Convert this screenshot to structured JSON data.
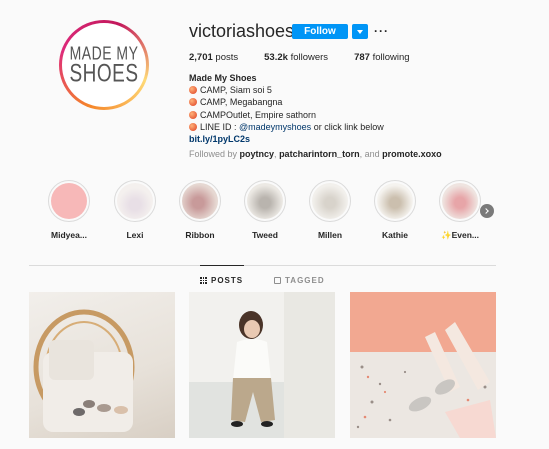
{
  "profile": {
    "avatar_text_line1": "MADE MY",
    "avatar_text_line2": "SHOES",
    "username": "victoriashoes",
    "follow_label": "Follow",
    "more_label": "···",
    "stats": {
      "posts_count": "2,701",
      "posts_label": "posts",
      "followers_count": "53.2k",
      "followers_label": "followers",
      "following_count": "787",
      "following_label": "following"
    },
    "bio": {
      "name": "Made My Shoes",
      "line1": "CAMP, Siam soi 5",
      "line2": "CAMP, Megabangna",
      "line3": "CAMPOutlet, Empire sathorn",
      "line4_prefix": "LINE ID : ",
      "line4_mention": "@madeymyshoes",
      "line4_suffix": " or click link below",
      "link": "bit.ly/1pyLC2s",
      "followed_prefix": "Followed by ",
      "followed_user1": "poytncy",
      "followed_sep1": ", ",
      "followed_user2": "patcharintorn_torn",
      "followed_sep2": ", and ",
      "followed_user3": "promote.xoxo"
    }
  },
  "highlights": [
    {
      "label": "Midyea..."
    },
    {
      "label": "Lexi"
    },
    {
      "label": "Ribbon"
    },
    {
      "label": "Tweed"
    },
    {
      "label": "Millen"
    },
    {
      "label": "Kathie"
    },
    {
      "label": "✨Even..."
    }
  ],
  "tabs": {
    "posts": "POSTS",
    "tagged": "TAGGED"
  },
  "colors": {
    "accent": "#0095f6",
    "text": "#262626",
    "muted": "#8e8e8e",
    "link": "#00376b"
  },
  "icons": [
    "chevron-down-icon",
    "more-icon",
    "peach-emoji-icon",
    "grid-icon",
    "tag-icon",
    "chevron-right-icon"
  ]
}
